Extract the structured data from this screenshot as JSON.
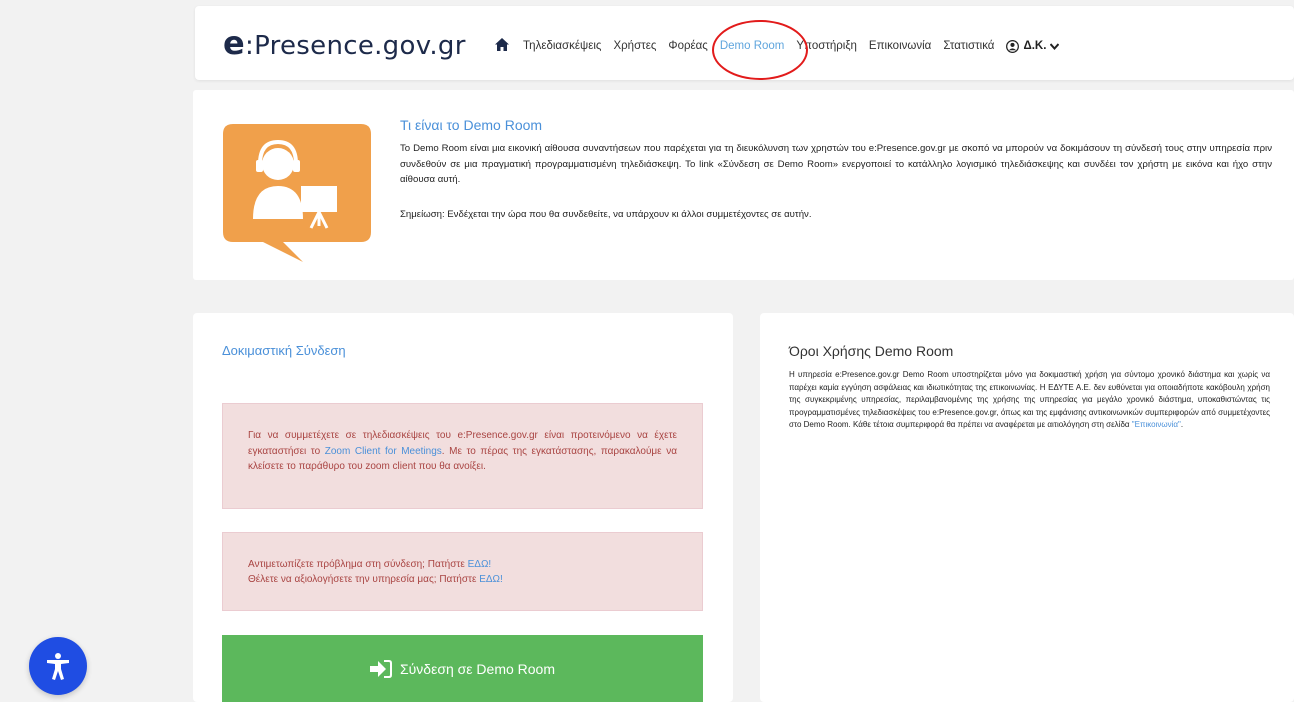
{
  "header": {
    "brand_e": "e",
    "brand_rest": ":Presence.gov.gr",
    "nav": {
      "teleconferences": "Τηλεδιασκέψεις",
      "users": "Χρήστες",
      "organization": "Φορέας",
      "demo_room": "Demo Room",
      "support": "Υποστήριξη",
      "contact": "Επικοινωνία",
      "statistics": "Στατιστικά",
      "user": "Δ.Κ."
    },
    "accent_color": "#5fa5dd",
    "annotation_color": "#e21b1b"
  },
  "intro": {
    "title": "Τι είναι το Demo Room",
    "text": "Το Demo Room είναι μια εικονική αίθουσα συναντήσεων που παρέχεται για τη διευκόλυνση των χρηστών του e:Presence.gov.gr με σκοπό να μπορούν να δοκιμάσουν τη σύνδεσή τους στην υπηρεσία πριν συνδεθούν σε μια πραγματική προγραμματισμένη τηλεδιάσκεψη. Το link «Σύνδεση σε Demo Room» ενεργοποιεί το κατάλληλο λογισμικό τηλεδιάσκεψης και συνδέει τον χρήστη με εικόνα και ήχο στην αίθουσα αυτή.",
    "note": "Σημείωση: Ενδέχεται την ώρα που θα συνδεθείτε, να υπάρχουν κι άλλοι συμμετέχοντες σε αυτήν."
  },
  "test_connection": {
    "title": "Δοκιμαστική Σύνδεση",
    "alert1": {
      "before": "Για να συμμετέχετε σε τηλεδιασκέψεις του e:Presence.gov.gr είναι προτεινόμενο να έχετε εγκαταστήσει το ",
      "link": "Zoom Client for Meetings",
      "after": ". Με το πέρας της εγκατάστασης, παρακαλούμε να κλείσετε το παράθυρο του zoom client που θα ανοίξει."
    },
    "alert2": {
      "line1": "Αντιμετωπίζετε πρόβλημα στη σύνδεση; Πατήστε ",
      "line1_link": "ΕΔΩ!",
      "line2": "Θέλετε να αξιολογήσετε την υπηρεσία μας; Πατήστε ",
      "line2_link": "ΕΔΩ!"
    },
    "button": "Σύνδεση σε Demo Room",
    "button_color": "#5cb85c"
  },
  "terms": {
    "title": "Όροι Χρήσης Demo Room",
    "text": "Η υπηρεσία e:Presence.gov.gr Demo Room υποστηρίζεται μόνο για δοκιμαστική χρήση για σύντομο χρονικό διάστημα και χωρίς να παρέχει καμία εγγύηση ασφάλειας και ιδιωτικότητας της επικοινωνίας. Η ΕΔΥΤΕ Α.Ε. δεν ευθύνεται για οποιαδήποτε κακόβουλη χρήση της συγκεκριμένης υπηρεσίας, περιλαμβανομένης της χρήσης της υπηρεσίας για μεγάλο χρονικό διάστημα, υποκαθιστώντας τις προγραμματισμένες τηλεδιασκέψεις του e:Presence.gov.gr, όπως και της εμφάνισης αντικοινωνικών συμπεριφορών από συμμετέχοντες στο Demo Room. Κάθε τέτοια συμπεριφορά θα πρέπει να αναφέρεται με αιτιολόγηση στη σελίδα ",
    "link": "\"Επικοινωνία\""
  }
}
